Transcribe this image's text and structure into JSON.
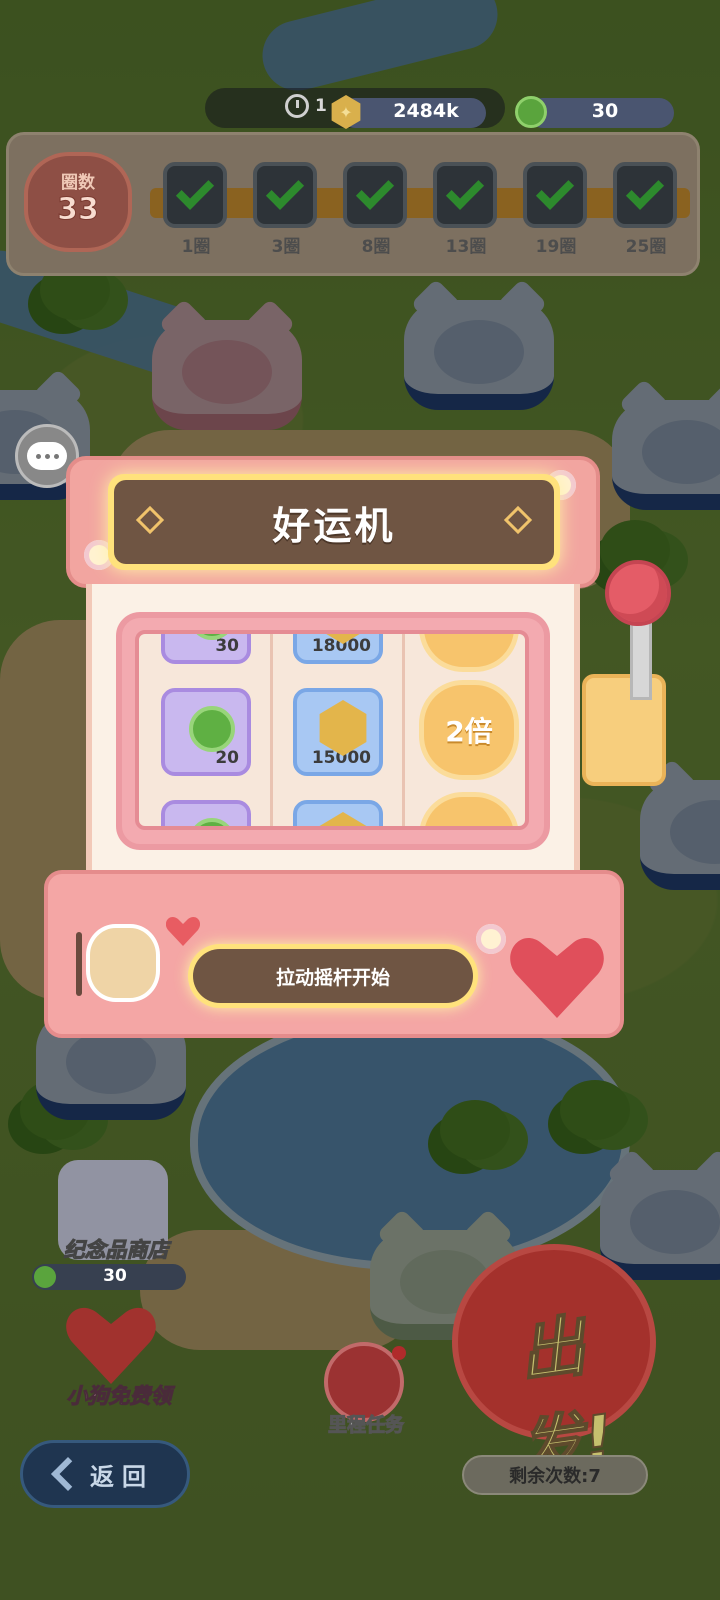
{
  "header": {
    "timer": "1",
    "coins": "2484k",
    "clovers": "30"
  },
  "laps": {
    "label": "圈数",
    "count": "33",
    "milestones": [
      {
        "label": "1圈",
        "done": true
      },
      {
        "label": "3圈",
        "done": true
      },
      {
        "label": "8圈",
        "done": true
      },
      {
        "label": "13圈",
        "done": true
      },
      {
        "label": "19圈",
        "done": true
      },
      {
        "label": "25圈",
        "done": true
      }
    ]
  },
  "slot_machine": {
    "title": "好运机",
    "reels": {
      "reel1": {
        "top": "30",
        "center": "20"
      },
      "reel2": {
        "top": "18000",
        "center": "15000"
      },
      "reel3": {
        "center": "2倍"
      }
    },
    "start_label": "拉动摇杆开始"
  },
  "shop": {
    "label": "纪念品商店",
    "price": "30"
  },
  "free_dog": {
    "label": "小狗免费领"
  },
  "mission": {
    "label": "里程任务"
  },
  "go_button": {
    "label": "出发!"
  },
  "back": {
    "label": "返回"
  },
  "remaining": {
    "label": "剩余次数:7"
  },
  "colors": {
    "machine_pink": "#f2a5a0",
    "title_gold": "#ffe27c",
    "title_brown": "#6f5543"
  }
}
